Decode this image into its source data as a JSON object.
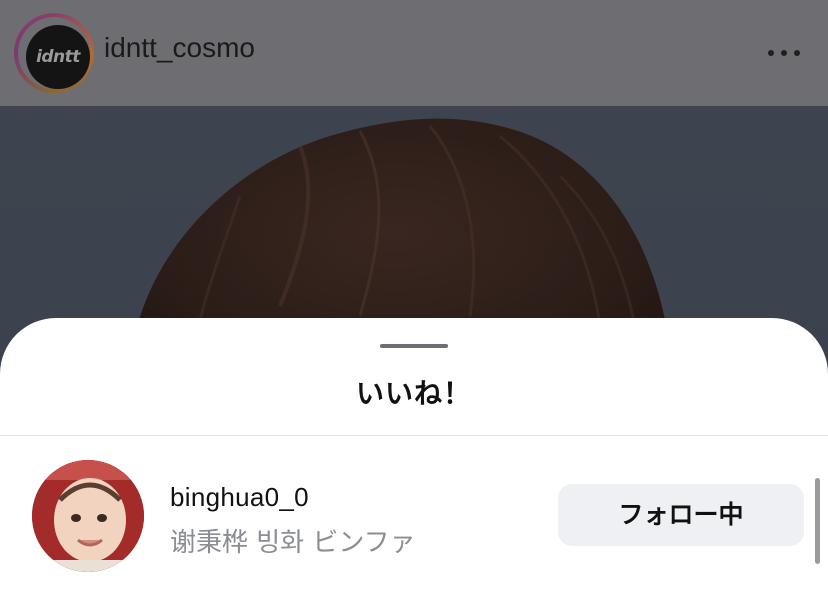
{
  "post": {
    "username": "idntt_cosmo",
    "avatar_text": "idntt",
    "more_icon": "more-horizontal-icon"
  },
  "likes_sheet": {
    "title": "いいね！",
    "users": [
      {
        "username": "binghua0_0",
        "full_name": "谢秉桦 빙화 ビンファ",
        "follow_label": "フォロー中"
      }
    ]
  },
  "colors": {
    "sheet_background": "#ffffff",
    "follow_button_bg": "#eff0f3",
    "secondary_text": "#8a8d92"
  }
}
